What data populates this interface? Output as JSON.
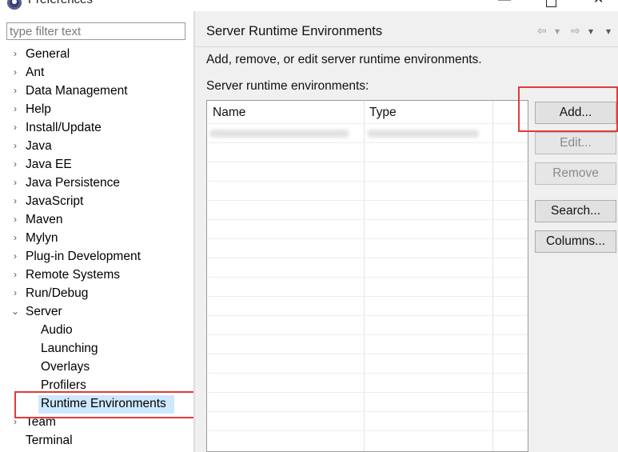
{
  "window": {
    "title": "Preferences",
    "minimize": "—",
    "close": "✕"
  },
  "left": {
    "filter_placeholder": "type filter text",
    "tree": [
      {
        "label": "General",
        "expander": "›"
      },
      {
        "label": "Ant",
        "expander": "›"
      },
      {
        "label": "Data Management",
        "expander": "›"
      },
      {
        "label": "Help",
        "expander": "›"
      },
      {
        "label": "Install/Update",
        "expander": "›"
      },
      {
        "label": "Java",
        "expander": "›"
      },
      {
        "label": "Java EE",
        "expander": "›"
      },
      {
        "label": "Java Persistence",
        "expander": "›"
      },
      {
        "label": "JavaScript",
        "expander": "›"
      },
      {
        "label": "Maven",
        "expander": "›"
      },
      {
        "label": "Mylyn",
        "expander": "›"
      },
      {
        "label": "Plug-in Development",
        "expander": "›"
      },
      {
        "label": "Remote Systems",
        "expander": "›"
      },
      {
        "label": "Run/Debug",
        "expander": "›"
      },
      {
        "label": "Server",
        "expander": "⌄",
        "children": [
          {
            "label": "Audio"
          },
          {
            "label": "Launching"
          },
          {
            "label": "Overlays"
          },
          {
            "label": "Profilers"
          },
          {
            "label": "Runtime Environments",
            "selected": true
          }
        ]
      },
      {
        "label": "Team",
        "expander": "›"
      },
      {
        "label": "Terminal",
        "expander": ""
      }
    ]
  },
  "right": {
    "title": "Server Runtime Environments",
    "nav": {
      "back": "⇦",
      "back_menu": "▾",
      "forward": "⇨",
      "forward_menu": "▾",
      "view_menu": "▾"
    },
    "description": "Add, remove, or edit server runtime environments.",
    "list_label": "Server runtime environments:",
    "table": {
      "columns": [
        "Name",
        "Type"
      ]
    },
    "buttons": {
      "add": "Add...",
      "edit": "Edit...",
      "remove": "Remove",
      "search": "Search...",
      "columns": "Columns..."
    }
  },
  "colors": {
    "selection": "#cde8ff",
    "highlight_box": "#e23a3a",
    "panel_bg": "#f0f0f0"
  }
}
